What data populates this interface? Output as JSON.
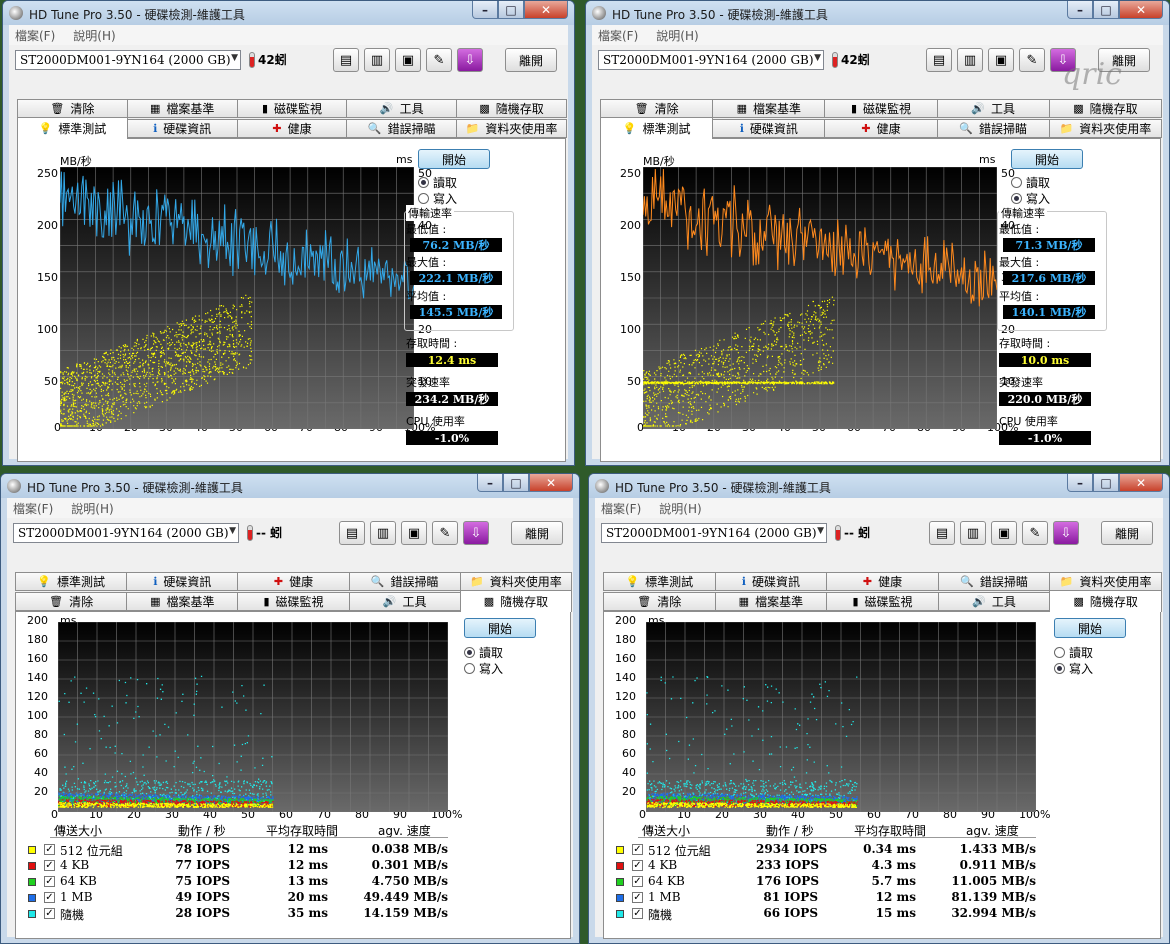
{
  "common": {
    "title": "HD Tune Pro 3.50 - 硬碟檢測-維護工具",
    "menu_file": "檔案(F)",
    "menu_help": "說明(H)",
    "drive": "ST2000DM001-9YN164 (2000 GB)",
    "exit": "離開",
    "start": "開始",
    "read": "讀取",
    "write": "寫入",
    "tabs": {
      "benchmark": "標準測試",
      "info": "硬碟資訊",
      "health": "健康",
      "error_scan": "錯誤掃瞄",
      "folder_usage": "資料夾使用率",
      "erase": "清除",
      "file_benchmark": "檔案基準",
      "disk_monitor": "磁碟監視",
      "tools": "工具",
      "random_access": "隨機存取"
    },
    "bench_labels": {
      "transfer": "傳輸速率",
      "min": "最低值 :",
      "max": "最大值 :",
      "avg": "平均值 :",
      "access": "存取時間 :",
      "burst": "突發速率",
      "cpu": "CPU 使用率"
    },
    "bench_axis": {
      "left_unit": "MB/秒",
      "right_unit": "ms",
      "left_ticks": [
        "250",
        "200",
        "150",
        "100",
        "50"
      ],
      "right_ticks": [
        "50",
        "40",
        "30",
        "20",
        "10"
      ],
      "x_ticks": [
        "0",
        "10",
        "20",
        "30",
        "40",
        "50",
        "60",
        "70",
        "80",
        "90",
        "100%"
      ]
    },
    "random_axis": {
      "unit": "ms",
      "y_ticks": [
        "200",
        "180",
        "160",
        "140",
        "120",
        "100",
        "80",
        "60",
        "40",
        "20"
      ],
      "x_ticks": [
        "0",
        "10",
        "20",
        "30",
        "40",
        "50",
        "60",
        "70",
        "80",
        "90",
        "100%"
      ]
    },
    "random_headers": {
      "size": "傳送大小",
      "ops": "動作 / 秒",
      "avg_access": "平均存取時間",
      "speed": "agv. 速度"
    },
    "random_sizes": [
      "512 位元組",
      "4 KB",
      "64 KB",
      "1 MB",
      "隨機"
    ],
    "checkmark": "✓"
  },
  "win1": {
    "temp": "42蚓",
    "mode": "read",
    "min": "76.2 MB/秒",
    "max": "222.1 MB/秒",
    "avg": "145.5 MB/秒",
    "access": "12.4 ms",
    "burst": "234.2 MB/秒",
    "cpu": "-1.0%",
    "line_color": "#33a8e8"
  },
  "win2": {
    "temp": "42蚓",
    "mode": "write",
    "min": "71.3 MB/秒",
    "max": "217.6 MB/秒",
    "avg": "140.1 MB/秒",
    "access": "10.0 ms",
    "burst": "220.0 MB/秒",
    "cpu": "-1.0%",
    "line_color": "#ff8a1e",
    "watermark": "qric"
  },
  "win3": {
    "temp": "-- 蚓",
    "mode": "read",
    "rows": [
      {
        "ops": "78 IOPS",
        "access": "12 ms",
        "speed": "0.038 MB/s"
      },
      {
        "ops": "77 IOPS",
        "access": "12 ms",
        "speed": "0.301 MB/s"
      },
      {
        "ops": "75 IOPS",
        "access": "13 ms",
        "speed": "4.750 MB/s"
      },
      {
        "ops": "49 IOPS",
        "access": "20 ms",
        "speed": "49.449 MB/s"
      },
      {
        "ops": "28 IOPS",
        "access": "35 ms",
        "speed": "14.159 MB/s"
      }
    ]
  },
  "win4": {
    "temp": "-- 蚓",
    "mode": "write",
    "rows": [
      {
        "ops": "2934 IOPS",
        "access": "0.34 ms",
        "speed": "1.433 MB/s"
      },
      {
        "ops": "233 IOPS",
        "access": "4.3 ms",
        "speed": "0.911 MB/s"
      },
      {
        "ops": "176 IOPS",
        "access": "5.7 ms",
        "speed": "11.005 MB/s"
      },
      {
        "ops": "81 IOPS",
        "access": "12 ms",
        "speed": "81.139 MB/s"
      },
      {
        "ops": "66 IOPS",
        "access": "15 ms",
        "speed": "32.994 MB/s"
      }
    ]
  },
  "size_colors": [
    "#ffff00",
    "#e01010",
    "#20d020",
    "#1e6ee8",
    "#20e8e8"
  ]
}
